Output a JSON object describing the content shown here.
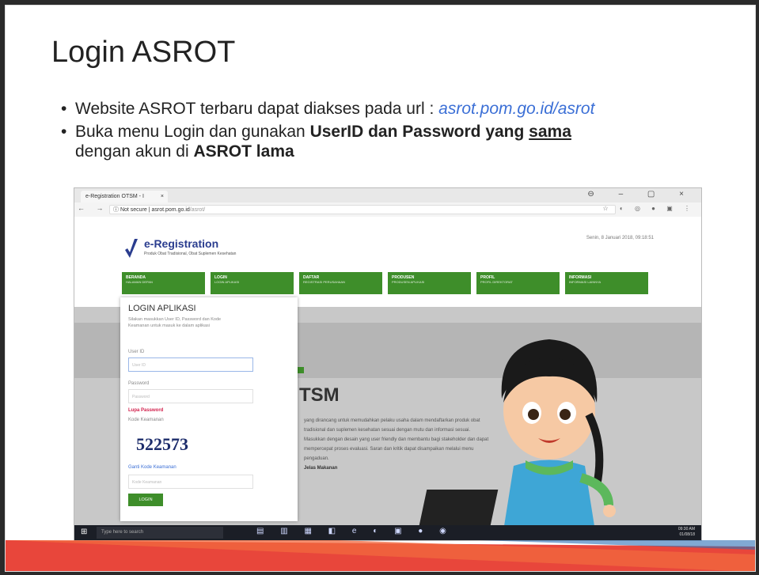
{
  "slide": {
    "title": "Login ASROT",
    "bullets": {
      "b1_text": "Website ASROT terbaru dapat diakses pada url : ",
      "b1_url": "asrot.pom.go.id/asrot",
      "b2_pre": "Buka menu Login dan gunakan ",
      "b2_bold": "UserID dan Password yang ",
      "b2_underline": "sama",
      "b2_line2_pre": "dengan akun di ",
      "b2_line2_bold": "ASROT lama"
    }
  },
  "browser": {
    "tab_title": "e-Registration OTSM - I",
    "tab_close": "×",
    "window_controls": "⊖ – ▢ ×",
    "nav_buttons": "← → C",
    "security_label": "ⓘ Not secure",
    "url": "asrot.pom.go.id",
    "url_path": "/asrot/",
    "extensions": "☆ ◐ ◎ ● ▣ ⋮"
  },
  "site": {
    "logo_title": "e-Registration",
    "logo_subtitle": "Produk Obat Tradisional, Obat Suplemen Kesehatan",
    "datetime": "Senin, 8 Januari 2018, 09:18:51",
    "menu": [
      {
        "label": "BERANDA",
        "sub": "HALAMAN DEPAN"
      },
      {
        "label": "LOGIN",
        "sub": "LOGIN APLIKASI"
      },
      {
        "label": "DAFTAR",
        "sub": "REGISTRASI PERUSAHAAN"
      },
      {
        "label": "PRODUSEN",
        "sub": "PRODUSEN APLIKASI"
      },
      {
        "label": "PROFIL",
        "sub": "PROFIL DIREKTORAT"
      },
      {
        "label": "INFORMASI",
        "sub": "INFORMASI LAINNYA"
      }
    ],
    "login": {
      "title": "LOGIN APLIKASI",
      "description": "Silakan masukkan User ID, Password dan Kode Keamanan untuk masuk ke dalam aplikasi",
      "userid_label": "User ID",
      "userid_placeholder": "User ID",
      "password_label": "Password",
      "password_placeholder": "Password",
      "forgot_password": "Lupa Password",
      "captcha_label": "Kode Keamanan",
      "captcha_value": "522573",
      "refresh_captcha": "Ganti Kode Keamanan",
      "captcha_placeholder": "Kode Keamanan",
      "login_button": "LOGIN"
    },
    "hero": {
      "heading": "TSM",
      "text": "yang dirancang untuk memudahkan pelaku usaha dalam mendaftarkan produk obat tradisional dan suplemen kesehatan sesuai dengan mutu dan informasi sesuai. Masukkan dengan desain yang user friendly dan membantu bagi stakeholder dan dapat mempercepat proses evaluasi. Saran dan kritik dapat disampaikan melalui menu pengaduan.",
      "link": "Jelas Makanan"
    }
  },
  "taskbar": {
    "start": "⊞",
    "search_placeholder": "Type here to search",
    "apps": "▤ ▥ ▦ ◧ e ◐ ▣ ● ◉",
    "time": "09:30 AM",
    "date": "01/08/18"
  }
}
